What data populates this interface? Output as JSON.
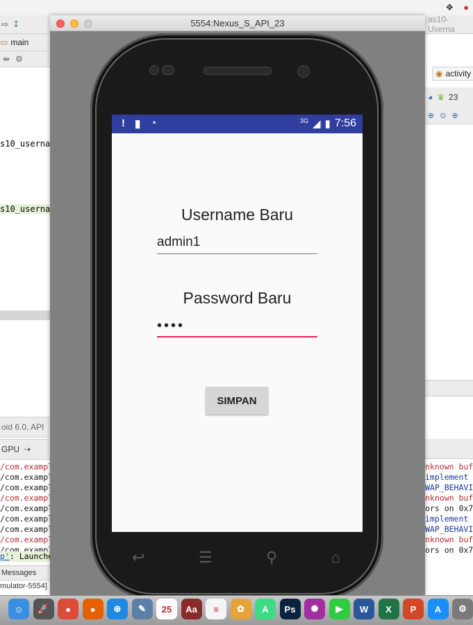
{
  "emulator": {
    "title": "5554:Nexus_S_API_23",
    "status_bar": {
      "left_icons": [
        "alert-icon",
        "sd-card-icon",
        "android-debug-icon"
      ],
      "network": "3G",
      "time": "7:56"
    },
    "form": {
      "username_label": "Username Baru",
      "username_value": "admin1",
      "password_label": "Password Baru",
      "password_value": "••••",
      "save_button": "SIMPAN"
    },
    "nav_keys": [
      "back-icon",
      "menu-icon",
      "search-icon",
      "home-icon"
    ]
  },
  "ide_left": {
    "crumb": "main",
    "code_lines": [
      "s10_usernar",
      "s10_usernar"
    ],
    "device_label": "oid 6.0, API",
    "gpu_label": "GPU",
    "log_lines": [
      {
        "text": "/com.exampl",
        "color": "#b03030"
      },
      {
        "text": "/com.exampl",
        "color": "#1a1a1a"
      },
      {
        "text": "/com.exampl",
        "color": "#1a1a1a"
      },
      {
        "text": "/com.exampl",
        "color": "#b03030"
      },
      {
        "text": "/com.exampl",
        "color": "#1a1a1a"
      },
      {
        "text": "/com.exampl",
        "color": "#1a1a1a"
      },
      {
        "text": "/com.exampl",
        "color": "#1a1a1a"
      },
      {
        "text": "/com.exampl",
        "color": "#b03030"
      },
      {
        "text": "/com.exampl",
        "color": "#1a1a1a"
      }
    ],
    "launched_link": "p'",
    "launched_text": ": Launched c",
    "messages_tab": "Messages",
    "status_text": "mulator-5554]"
  },
  "ide_right": {
    "title_fragment": "as10-Userna",
    "tab_label": "activity",
    "api_label": "23",
    "log_lines": [
      {
        "text": "nknown buf",
        "color": "#b03030"
      },
      {
        "text": " implement",
        "color": "#1a3a9a"
      },
      {
        "text": "WAP_BEHAVI",
        "color": "#1a3a9a"
      },
      {
        "text": "nknown buf",
        "color": "#b03030"
      },
      {
        "text": "ors on 0x7",
        "color": "#1a1a1a"
      },
      {
        "text": " implement",
        "color": "#1a3a9a"
      },
      {
        "text": "WAP_BEHAVI",
        "color": "#1a3a9a"
      },
      {
        "text": "nknown buf",
        "color": "#b03030"
      },
      {
        "text": "ors on 0x7",
        "color": "#1a1a1a"
      }
    ]
  },
  "dock": {
    "apps": [
      {
        "icon": "finder-icon",
        "color": "#3b8fe0",
        "glyph": "☺"
      },
      {
        "icon": "launchpad-icon",
        "color": "#555555",
        "glyph": "🚀"
      },
      {
        "icon": "chrome-icon",
        "color": "#dd4b39",
        "glyph": "●"
      },
      {
        "icon": "firefox-icon",
        "color": "#e66000",
        "glyph": "●"
      },
      {
        "icon": "safari-icon",
        "color": "#1e88e5",
        "glyph": "⊕"
      },
      {
        "icon": "preview-icon",
        "color": "#5b7fa6",
        "glyph": "✎"
      },
      {
        "icon": "calendar-icon",
        "color": "#ffffff",
        "glyph": "25"
      },
      {
        "icon": "dictionary-icon",
        "color": "#8b2a2a",
        "glyph": "Aa"
      },
      {
        "icon": "reminders-icon",
        "color": "#f5f5f5",
        "glyph": "≡"
      },
      {
        "icon": "photos-icon",
        "color": "#e8a23a",
        "glyph": "✿"
      },
      {
        "icon": "android-studio-icon",
        "color": "#3ddc84",
        "glyph": "A"
      },
      {
        "icon": "photoshop-icon",
        "color": "#0c2340",
        "glyph": "Ps"
      },
      {
        "icon": "color-app-icon",
        "color": "#a030a0",
        "glyph": "✺"
      },
      {
        "icon": "facetime-icon",
        "color": "#2ecc40",
        "glyph": "▶"
      },
      {
        "icon": "word-icon",
        "color": "#2b579a",
        "glyph": "W"
      },
      {
        "icon": "excel-icon",
        "color": "#217346",
        "glyph": "X"
      },
      {
        "icon": "powerpoint-icon",
        "color": "#d24726",
        "glyph": "P"
      },
      {
        "icon": "app-store-icon",
        "color": "#1c8ef9",
        "glyph": "A"
      },
      {
        "icon": "system-prefs-icon",
        "color": "#7a7a7a",
        "glyph": "⚙"
      }
    ]
  }
}
